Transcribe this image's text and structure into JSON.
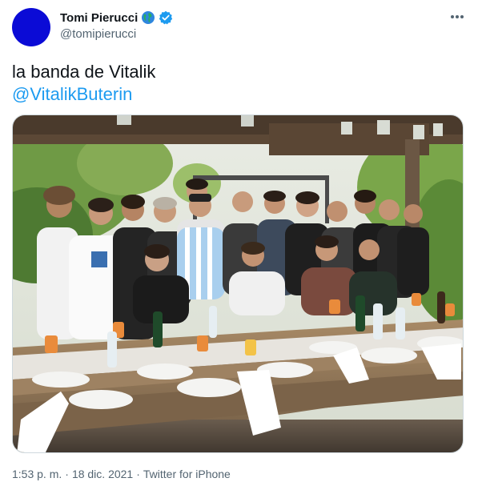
{
  "author": {
    "display_name": "Tomi Pierucci",
    "handle": "@tomipierucci",
    "avatar_color": "#0b0bd6",
    "badges": [
      "globe-icon",
      "verified-icon"
    ]
  },
  "tweet": {
    "text": "la banda de Vitalik",
    "mention": "@VitalikButerin"
  },
  "media": {
    "type": "photo",
    "alt": ""
  },
  "meta": {
    "time": "1:53 p. m.",
    "separator": "·",
    "date": "18 dic. 2021",
    "separator2": "·",
    "source": "Twitter for iPhone"
  },
  "colors": {
    "link": "#1d9bf0",
    "secondary_text": "#536471",
    "verified": "#1d9bf0"
  }
}
